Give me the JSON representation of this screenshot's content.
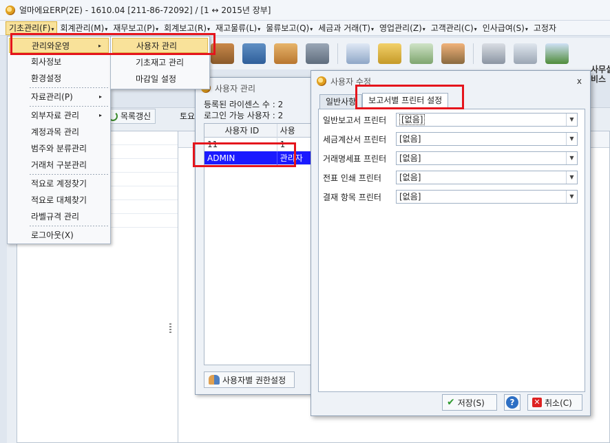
{
  "window": {
    "title": "얼마에요ERP(2E) - 1610.04 [211-86-72092] / [1 ↔ 2015년 장부]"
  },
  "menubar": [
    {
      "label": "기초관리(F)",
      "caret": "▾"
    },
    {
      "label": "회계관리(M)",
      "caret": "▾"
    },
    {
      "label": "재무보고(P)",
      "caret": "▾"
    },
    {
      "label": "회계보고(R)",
      "caret": "▾"
    },
    {
      "label": "재고물류(L)",
      "caret": "▾"
    },
    {
      "label": "물류보고(Q)",
      "caret": "▾"
    },
    {
      "label": "세금과 거래(T)",
      "caret": "▾"
    },
    {
      "label": "영업관리(Z)",
      "caret": "▾"
    },
    {
      "label": "고객관리(C)",
      "caret": "▾"
    },
    {
      "label": "인사급여(S)",
      "caret": "▾"
    },
    {
      "label": "고정자",
      "caret": ""
    }
  ],
  "dropdown": {
    "items": [
      {
        "label": "관리와운영",
        "submenu": "▸"
      },
      {
        "label": "회사정보",
        "submenu": ""
      },
      {
        "label": "환경설정",
        "submenu": ""
      },
      {
        "label": "자료관리(P)",
        "submenu": "▸"
      },
      {
        "label": "외부자료 관리",
        "submenu": "▸"
      },
      {
        "label": "계정과목 관리",
        "submenu": ""
      },
      {
        "label": "범주와 분류관리",
        "submenu": ""
      },
      {
        "label": "거래처 구분관리",
        "submenu": ""
      },
      {
        "label": "적요로 계정찾기",
        "submenu": ""
      },
      {
        "label": "적요로 대체찾기",
        "submenu": ""
      },
      {
        "label": "라벨규격 관리",
        "submenu": ""
      },
      {
        "label": "로그아웃(X)",
        "submenu": ""
      }
    ]
  },
  "submenu": {
    "items": [
      {
        "label": "사용자 관리"
      },
      {
        "label": "기초재고 관리"
      },
      {
        "label": "마감일 설정"
      }
    ]
  },
  "background": {
    "refresh_button": "목록갱신",
    "tab_label": "토요",
    "side_text": "사무실\n비스"
  },
  "user_dialog": {
    "title": "사용자 관리",
    "licenses": "등록된 라이센스 수 : 2",
    "login_users": "로그인 가능 사용자 : 2",
    "columns": [
      "사용자 ID",
      "사용"
    ],
    "rows": [
      [
        "11",
        "1"
      ],
      [
        "ADMIN",
        "관리자"
      ]
    ],
    "permission_button": "사용자별 권한설정"
  },
  "edit_dialog": {
    "title": "사용자 수정",
    "close": "x",
    "tabs": [
      "일반사항",
      "보고서별 프린터 설정"
    ],
    "fields": [
      {
        "label": "일반보고서 프린터",
        "value": "[없음]"
      },
      {
        "label": "세금계산서 프린터",
        "value": "[없음]"
      },
      {
        "label": "거래명세표 프린터",
        "value": "[없음]"
      },
      {
        "label": "전표 인쇄 프린터",
        "value": "[없음]"
      },
      {
        "label": "결재 항목 프린터",
        "value": "[없음]"
      }
    ],
    "save_button": "저장(S)",
    "help_button": "?",
    "cancel_button": "취소(C)"
  }
}
